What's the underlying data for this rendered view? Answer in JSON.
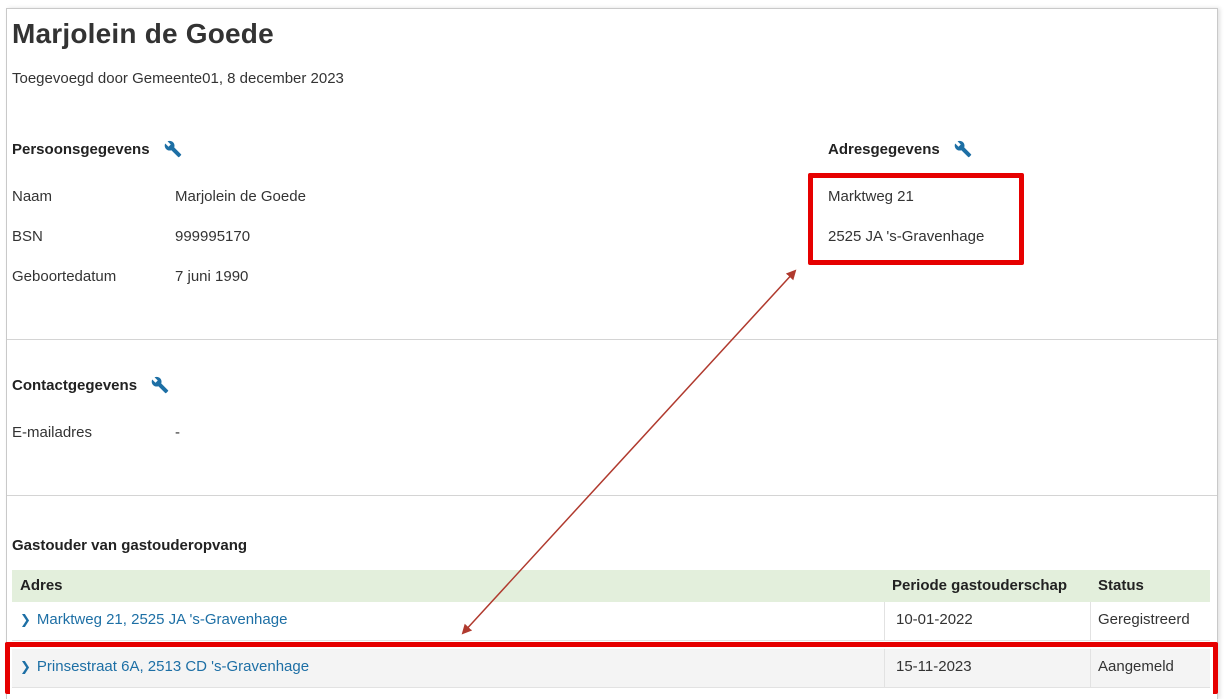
{
  "header": {
    "name": "Marjolein de Goede",
    "subtitle": "Toegevoegd door Gemeente01, 8 december 2023"
  },
  "persoonsgegevens": {
    "title": "Persoonsgegevens",
    "rows": [
      {
        "label": "Naam",
        "value": "Marjolein de Goede"
      },
      {
        "label": "BSN",
        "value": "999995170"
      },
      {
        "label": "Geboortedatum",
        "value": "7 juni 1990"
      }
    ]
  },
  "adresgegevens": {
    "title": "Adresgegevens",
    "line1": "Marktweg 21",
    "line2": "2525 JA 's-Gravenhage"
  },
  "contactgegevens": {
    "title": "Contactgegevens",
    "email_label": "E-mailadres",
    "email_value": "-"
  },
  "gastouder": {
    "title": "Gastouder van gastouderopvang",
    "columns": [
      "Adres",
      "Periode gastouderschap",
      "Status"
    ],
    "rows": [
      {
        "address": "Marktweg 21, 2525 JA 's-Gravenhage",
        "period": "10-01-2022",
        "status": "Geregistreerd"
      },
      {
        "address": "Prinsestraat 6A, 2513 CD 's-Gravenhage",
        "period": "15-11-2023",
        "status": "Aangemeld"
      }
    ]
  },
  "colors": {
    "link": "#1d6fa5",
    "highlight": "#e60000",
    "arrow": "#b03a2e",
    "table_header_bg": "#e3efdc",
    "icon": "#1d6fa5"
  },
  "icons": {
    "edit": "wrench-icon",
    "row_expand": "chevron-right-icon"
  }
}
